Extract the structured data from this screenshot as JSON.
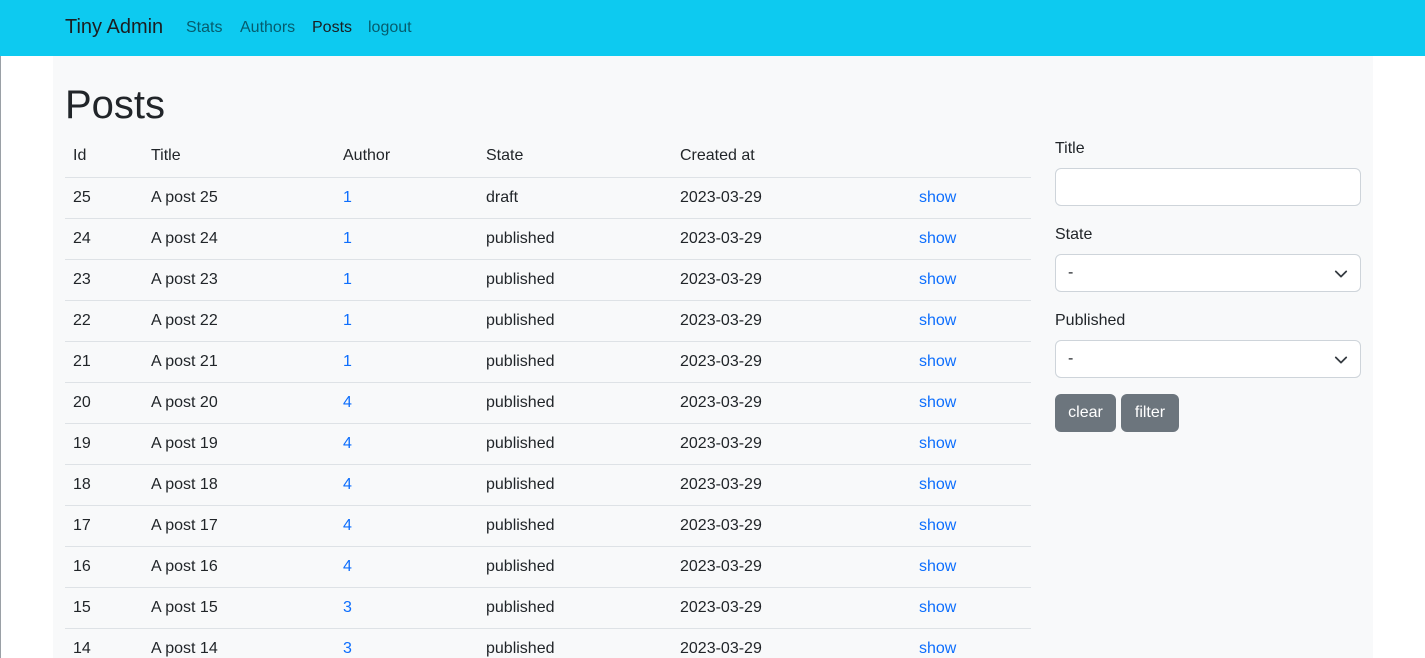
{
  "nav": {
    "brand": "Tiny Admin",
    "links": [
      "Stats",
      "Authors",
      "Posts",
      "logout"
    ]
  },
  "page": {
    "title": "Posts"
  },
  "table": {
    "headers": [
      "Id",
      "Title",
      "Author",
      "State",
      "Created at"
    ],
    "rows": [
      {
        "id": "25",
        "title": "A post 25",
        "author": "1",
        "state": "draft",
        "created": "2023-03-29",
        "action": "show"
      },
      {
        "id": "24",
        "title": "A post 24",
        "author": "1",
        "state": "published",
        "created": "2023-03-29",
        "action": "show"
      },
      {
        "id": "23",
        "title": "A post 23",
        "author": "1",
        "state": "published",
        "created": "2023-03-29",
        "action": "show"
      },
      {
        "id": "22",
        "title": "A post 22",
        "author": "1",
        "state": "published",
        "created": "2023-03-29",
        "action": "show"
      },
      {
        "id": "21",
        "title": "A post 21",
        "author": "1",
        "state": "published",
        "created": "2023-03-29",
        "action": "show"
      },
      {
        "id": "20",
        "title": "A post 20",
        "author": "4",
        "state": "published",
        "created": "2023-03-29",
        "action": "show"
      },
      {
        "id": "19",
        "title": "A post 19",
        "author": "4",
        "state": "published",
        "created": "2023-03-29",
        "action": "show"
      },
      {
        "id": "18",
        "title": "A post 18",
        "author": "4",
        "state": "published",
        "created": "2023-03-29",
        "action": "show"
      },
      {
        "id": "17",
        "title": "A post 17",
        "author": "4",
        "state": "published",
        "created": "2023-03-29",
        "action": "show"
      },
      {
        "id": "16",
        "title": "A post 16",
        "author": "4",
        "state": "published",
        "created": "2023-03-29",
        "action": "show"
      },
      {
        "id": "15",
        "title": "A post 15",
        "author": "3",
        "state": "published",
        "created": "2023-03-29",
        "action": "show"
      },
      {
        "id": "14",
        "title": "A post 14",
        "author": "3",
        "state": "published",
        "created": "2023-03-29",
        "action": "show"
      }
    ]
  },
  "filters": {
    "title_label": "Title",
    "title_value": "",
    "state_label": "State",
    "state_value": "-",
    "published_label": "Published",
    "published_value": "-",
    "clear_label": "clear",
    "filter_label": "filter"
  },
  "icons": {
    "select": "chevron-down-icon"
  },
  "colors": {
    "navbar": "#0dcaf0",
    "link": "#0d6efd",
    "button": "#6c757d",
    "content_bg": "#f8f9fa"
  }
}
